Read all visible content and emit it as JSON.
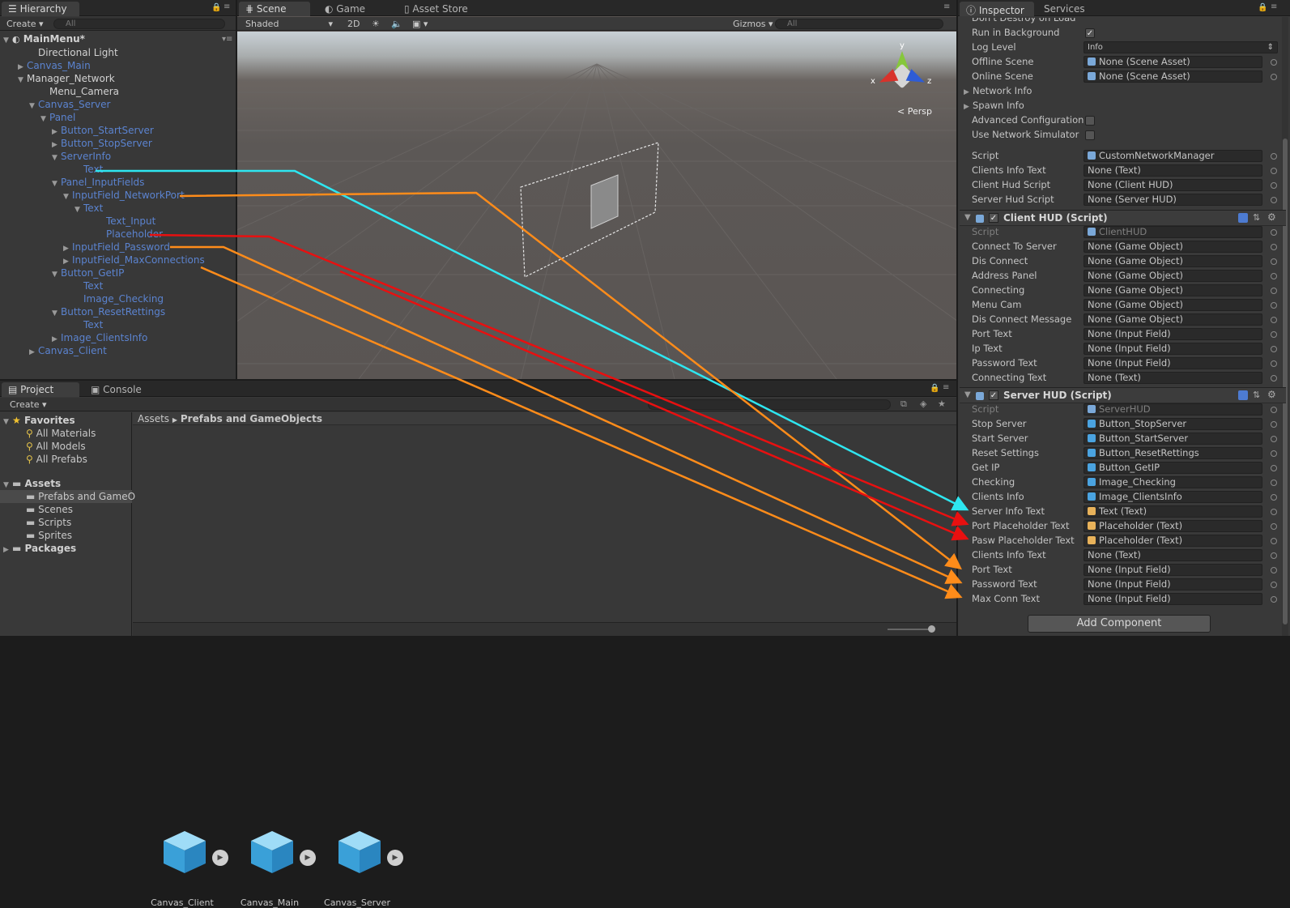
{
  "hierarchy": {
    "tab": "Hierarchy",
    "create": "Create",
    "search_placeholder": "All",
    "scene_name": "MainMenu*",
    "items": [
      {
        "label": "Directional Light",
        "indent": 2,
        "arrow": "",
        "color": "white"
      },
      {
        "label": "Canvas_Main",
        "indent": 1,
        "arrow": "▶",
        "color": "blue"
      },
      {
        "label": "Manager_Network",
        "indent": 1,
        "arrow": "▼",
        "color": "white"
      },
      {
        "label": "Menu_Camera",
        "indent": 3,
        "arrow": "",
        "color": "white"
      },
      {
        "label": "Canvas_Server",
        "indent": 2,
        "arrow": "▼",
        "color": "blue"
      },
      {
        "label": "Panel",
        "indent": 3,
        "arrow": "▼",
        "color": "blue"
      },
      {
        "label": "Button_StartServer",
        "indent": 4,
        "arrow": "▶",
        "color": "blue"
      },
      {
        "label": "Button_StopServer",
        "indent": 4,
        "arrow": "▶",
        "color": "blue"
      },
      {
        "label": "ServerInfo",
        "indent": 4,
        "arrow": "▼",
        "color": "blue"
      },
      {
        "label": "Text",
        "indent": 6,
        "arrow": "",
        "color": "blue"
      },
      {
        "label": "Panel_InputFields",
        "indent": 4,
        "arrow": "▼",
        "color": "blue"
      },
      {
        "label": "InputField_NetworkPort",
        "indent": 5,
        "arrow": "▼",
        "color": "blue"
      },
      {
        "label": "Text",
        "indent": 6,
        "arrow": "▼",
        "color": "blue"
      },
      {
        "label": "Text_Input",
        "indent": 8,
        "arrow": "",
        "color": "blue"
      },
      {
        "label": "Placeholder",
        "indent": 8,
        "arrow": "",
        "color": "blue"
      },
      {
        "label": "InputField_Password",
        "indent": 5,
        "arrow": "▶",
        "color": "blue"
      },
      {
        "label": "InputField_MaxConnections",
        "indent": 5,
        "arrow": "▶",
        "color": "blue"
      },
      {
        "label": "Button_GetIP",
        "indent": 4,
        "arrow": "▼",
        "color": "blue"
      },
      {
        "label": "Text",
        "indent": 6,
        "arrow": "",
        "color": "blue"
      },
      {
        "label": "Image_Checking",
        "indent": 6,
        "arrow": "",
        "color": "blue"
      },
      {
        "label": "Button_ResetRettings",
        "indent": 4,
        "arrow": "▼",
        "color": "blue"
      },
      {
        "label": "Text",
        "indent": 6,
        "arrow": "",
        "color": "blue"
      },
      {
        "label": "Image_ClientsInfo",
        "indent": 4,
        "arrow": "▶",
        "color": "blue"
      },
      {
        "label": "Canvas_Client",
        "indent": 2,
        "arrow": "▶",
        "color": "blue"
      }
    ]
  },
  "scene": {
    "tabs": [
      "Scene",
      "Game",
      "Asset Store"
    ],
    "shading": "Shaded",
    "mode_2d": "2D",
    "gizmos": "Gizmos",
    "search_placeholder": "All",
    "persp": "Persp",
    "axis_x": "x",
    "axis_y": "y",
    "axis_z": "z"
  },
  "project": {
    "tabs": [
      "Project",
      "Console"
    ],
    "create": "Create",
    "favorites_label": "Favorites",
    "favorites": [
      "All Materials",
      "All Models",
      "All Prefabs"
    ],
    "assets_label": "Assets",
    "folders": [
      "Prefabs and GameO",
      "Scenes",
      "Scripts",
      "Sprites"
    ],
    "packages_label": "Packages",
    "breadcrumb": [
      "Assets",
      "Prefabs and GameObjects"
    ],
    "prefabs": [
      "Canvas_Client",
      "Canvas_Main",
      "Canvas_Server"
    ]
  },
  "inspector": {
    "tabs": [
      "Inspector",
      "Services"
    ],
    "partial_top": "Don't Destroy on Load",
    "network_rows": [
      {
        "label": "Run in Background",
        "type": "check",
        "value": "✓"
      },
      {
        "label": "Log Level",
        "type": "select",
        "value": "Info"
      },
      {
        "label": "Offline Scene",
        "type": "field",
        "value": "None (Scene Asset)"
      },
      {
        "label": "Online Scene",
        "type": "field",
        "value": "None (Scene Asset)"
      },
      {
        "label": "Network Info",
        "type": "fold",
        "value": ""
      },
      {
        "label": "Spawn Info",
        "type": "fold",
        "value": ""
      },
      {
        "label": "Advanced Configuration",
        "type": "check",
        "value": ""
      },
      {
        "label": "Use Network Simulator",
        "type": "check",
        "value": ""
      }
    ],
    "manager_rows": [
      {
        "label": "Script",
        "value": "CustomNetworkManager",
        "icon": "script"
      },
      {
        "label": "Clients Info Text",
        "value": "None (Text)",
        "icon": ""
      },
      {
        "label": "Client Hud Script",
        "value": "None (Client HUD)",
        "icon": ""
      },
      {
        "label": "Server Hud Script",
        "value": "None (Server HUD)",
        "icon": ""
      }
    ],
    "client_hud": {
      "title": "Client HUD (Script)",
      "script_label": "Script",
      "script_value": "ClientHUD",
      "rows": [
        {
          "label": "Connect To Server",
          "value": "None (Game Object)"
        },
        {
          "label": "Dis Connect",
          "value": "None (Game Object)"
        },
        {
          "label": "Address Panel",
          "value": "None (Game Object)"
        },
        {
          "label": "Connecting",
          "value": "None (Game Object)"
        },
        {
          "label": "Menu Cam",
          "value": "None (Game Object)"
        },
        {
          "label": "Dis Connect Message",
          "value": "None (Game Object)"
        },
        {
          "label": "Port Text",
          "value": "None (Input Field)"
        },
        {
          "label": "Ip Text",
          "value": "None (Input Field)"
        },
        {
          "label": "Password Text",
          "value": "None (Input Field)"
        },
        {
          "label": "Connecting Text",
          "value": "None (Text)"
        }
      ]
    },
    "server_hud": {
      "title": "Server HUD (Script)",
      "script_label": "Script",
      "script_value": "ServerHUD",
      "rows": [
        {
          "label": "Stop Server",
          "value": "Button_StopServer",
          "icon": "go"
        },
        {
          "label": "Start Server",
          "value": "Button_StartServer",
          "icon": "go"
        },
        {
          "label": "Reset Settings",
          "value": "Button_ResetRettings",
          "icon": "go"
        },
        {
          "label": "Get IP",
          "value": "Button_GetIP",
          "icon": "go"
        },
        {
          "label": "Checking",
          "value": "Image_Checking",
          "icon": "go"
        },
        {
          "label": "Clients Info",
          "value": "Image_ClientsInfo",
          "icon": "go"
        },
        {
          "label": "Server Info Text",
          "value": "Text (Text)",
          "icon": "text"
        },
        {
          "label": "Port Placeholder Text",
          "value": "Placeholder (Text)",
          "icon": "text"
        },
        {
          "label": "Pasw Placeholder Text",
          "value": "Placeholder (Text)",
          "icon": "text"
        },
        {
          "label": "Clients Info Text",
          "value": "None (Text)",
          "icon": ""
        },
        {
          "label": "Port Text",
          "value": "None (Input Field)",
          "icon": ""
        },
        {
          "label": "Password Text",
          "value": "None (Input Field)",
          "icon": ""
        },
        {
          "label": "Max Conn Text",
          "value": "None (Input Field)",
          "icon": ""
        }
      ]
    },
    "add_component": "Add Component"
  },
  "colors": {
    "arrow_cyan": "#2ee6f0",
    "arrow_orange": "#ff8c1a",
    "arrow_red": "#e81010",
    "hierarchy_blue": "#5b83cf"
  }
}
